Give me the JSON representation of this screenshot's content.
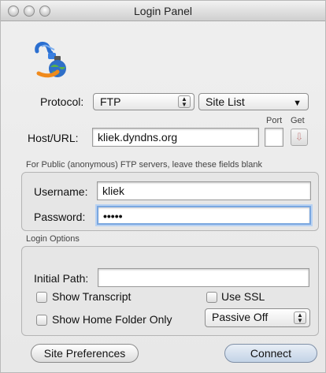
{
  "window": {
    "title": "Login Panel"
  },
  "protocol": {
    "label": "Protocol:",
    "selected": "FTP",
    "site_list": "Site List"
  },
  "host": {
    "label": "Host/URL:",
    "value": "kliek.dyndns.org",
    "port_label": "Port",
    "get_label": "Get"
  },
  "hint": "For Public (anonymous) FTP servers, leave these fields blank",
  "credentials": {
    "username_label": "Username:",
    "username_value": "kliek",
    "password_label": "Password:",
    "password_value": "•••••"
  },
  "options": {
    "section_label": "Login Options",
    "initial_path_label": "Initial Path:",
    "initial_path_value": "",
    "show_transcript": "Show Transcript",
    "use_ssl": "Use SSL",
    "show_home_folder_only": "Show Home Folder Only",
    "passive_selected": "Passive Off"
  },
  "buttons": {
    "site_preferences": "Site Preferences",
    "connect": "Connect"
  },
  "colors": {
    "focus_ring": "#7aa7e0",
    "default_button": "#c3d3e6"
  }
}
